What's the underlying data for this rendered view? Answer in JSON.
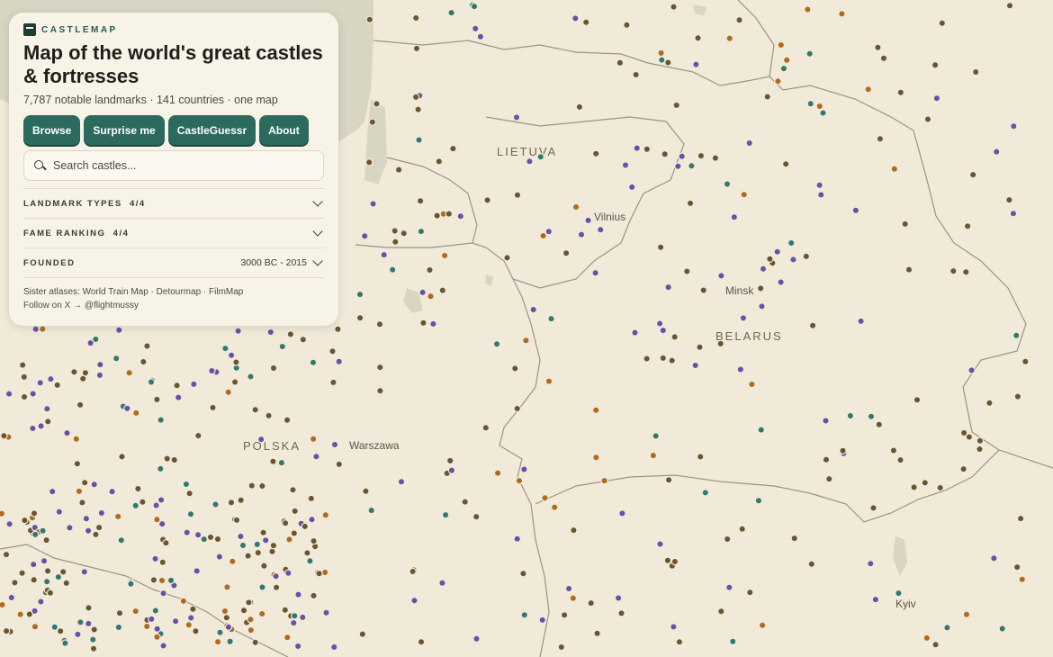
{
  "brand": {
    "name": "CASTLEMAP"
  },
  "title": "Map of the world's great castles & fortresses",
  "subtitle": "7,787 notable landmarks · 141 countries · one map",
  "buttons": [
    "Browse",
    "Surprise me",
    "CastleGuessr",
    "About"
  ],
  "search": {
    "placeholder": "Search castles..."
  },
  "filters": {
    "landmark_types": {
      "label": "LANDMARK TYPES",
      "count": "4/4"
    },
    "fame_ranking": {
      "label": "FAME RANKING",
      "count": "4/4"
    },
    "founded": {
      "label": "FOUNDED",
      "range": "3000 BC - 2015"
    }
  },
  "footer": {
    "sister_prefix": "Sister atlases:",
    "sister_links": [
      "World Train Map",
      "Detourmap",
      "FilmMap"
    ],
    "follow_prefix": "Follow on X →",
    "follow_handle": "@flightmussy"
  },
  "map": {
    "countries": [
      "LIETUVA",
      "BELARUS",
      "POLSKA"
    ],
    "cities": [
      "Vilnius",
      "Minsk",
      "Warszawa",
      "Kyiv"
    ],
    "colors": {
      "background": "#f1ead9",
      "water": "#d9d7c8",
      "border": "#9a9485",
      "brown_marker": "#6b5530",
      "orange_marker": "#b06a1e",
      "purple_marker": "#6a4fa8",
      "teal_marker": "#2f7a6c"
    }
  }
}
